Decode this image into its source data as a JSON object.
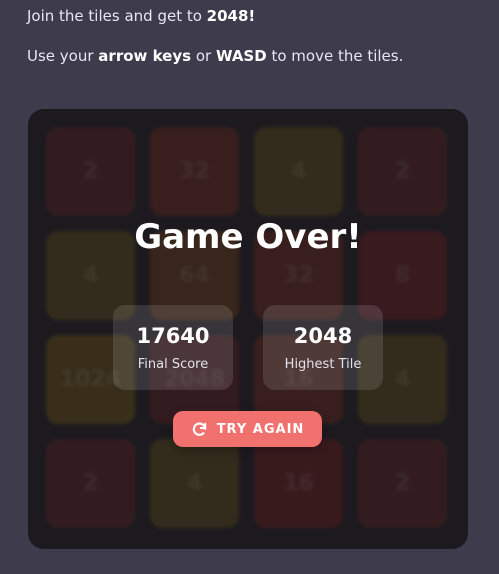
{
  "instructions": {
    "line1_text": "Join the tiles and get to ",
    "line1_goal": "2048!",
    "line2_prefix": "Use your ",
    "line2_keys1": "arrow keys",
    "line2_or": " or ",
    "line2_keys2": "WASD",
    "line2_suffix": " to move the tiles."
  },
  "board": {
    "tiles": [
      {
        "value": "2",
        "color": "#5a2424"
      },
      {
        "value": "32",
        "color": "#6a2a1e"
      },
      {
        "value": "4",
        "color": "#5c4a18"
      },
      {
        "value": "2",
        "color": "#5a2424"
      },
      {
        "value": "4",
        "color": "#5c4a18"
      },
      {
        "value": "64",
        "color": "#6a3a1a"
      },
      {
        "value": "32",
        "color": "#6a2a1e"
      },
      {
        "value": "8",
        "color": "#6a1e22"
      },
      {
        "value": "1024",
        "color": "#6a5216"
      },
      {
        "value": "2048",
        "color": "#5e2222"
      },
      {
        "value": "16",
        "color": "#6a2a1e"
      },
      {
        "value": "4",
        "color": "#5c4a18"
      },
      {
        "value": "2",
        "color": "#5a2424"
      },
      {
        "value": "4",
        "color": "#5c4a18"
      },
      {
        "value": "16",
        "color": "#6a1e1e"
      },
      {
        "value": "2",
        "color": "#5a2424"
      }
    ]
  },
  "game_over": {
    "title": "Game Over!",
    "final_score": "17640",
    "final_score_label": "Final Score",
    "highest_tile": "2048",
    "highest_tile_label": "Highest Tile",
    "try_again_label": "TRY AGAIN",
    "try_again_icon": "refresh-icon",
    "accent_color": "#f1716f"
  }
}
